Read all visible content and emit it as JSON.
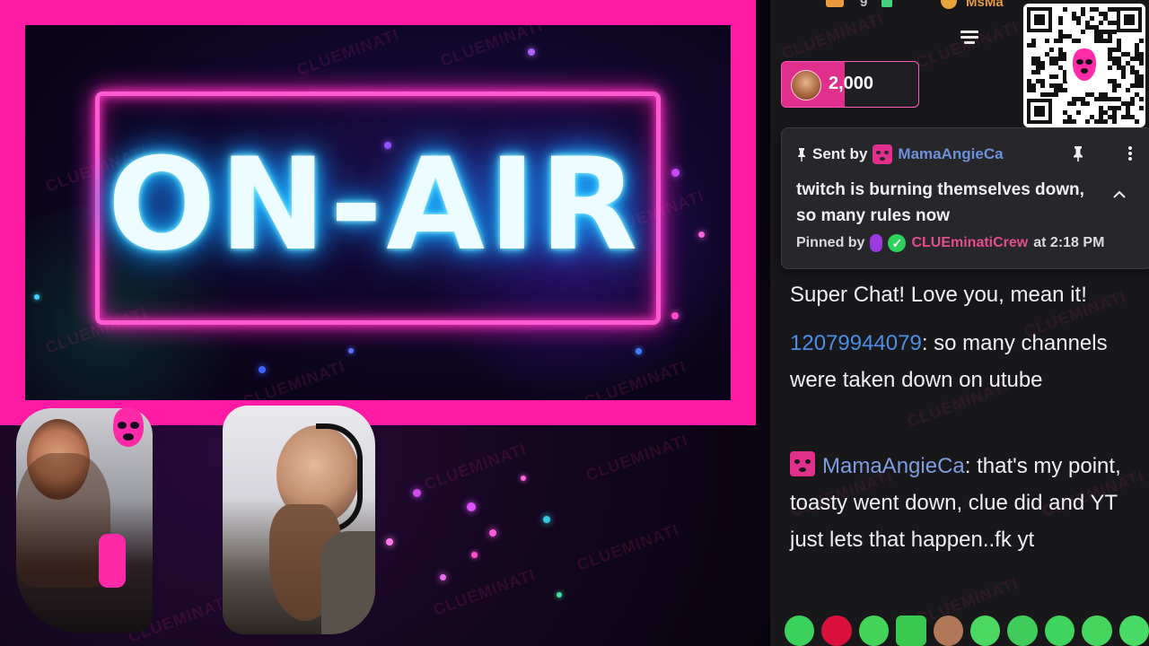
{
  "stream": {
    "on_air_text": "ON-AIR",
    "watermark_text": "CLUEMINATI"
  },
  "chat": {
    "top_users": [
      "9",
      "MsMa"
    ],
    "hype_badge": {
      "amount": "2,000"
    },
    "pinned": {
      "sent_by_label": "Sent by",
      "sender": "MamaAngieCa",
      "message": "twitch is burning themselves down, so many rules now",
      "pinned_by_label": "Pinned by",
      "pinned_by_user": "CLUEminatiCrew",
      "time": "at 2:18 PM"
    },
    "messages": [
      {
        "user": "",
        "text": "Super Chat! Love you, mean it!"
      },
      {
        "user": "12079944079",
        "text": ": so many channels were taken down on utube"
      },
      {
        "user": "MamaAngieCa",
        "text": ": that's my point, toasty went down, clue did and YT just lets that happen..fk yt"
      }
    ]
  },
  "colors": {
    "frame_pink": "#ff1aa4",
    "neon_blue": "#2ed6ff",
    "chat_bg": "#18181b",
    "username_blue": "#4a8ee8",
    "pinned_by_pink": "#e64d8c"
  }
}
